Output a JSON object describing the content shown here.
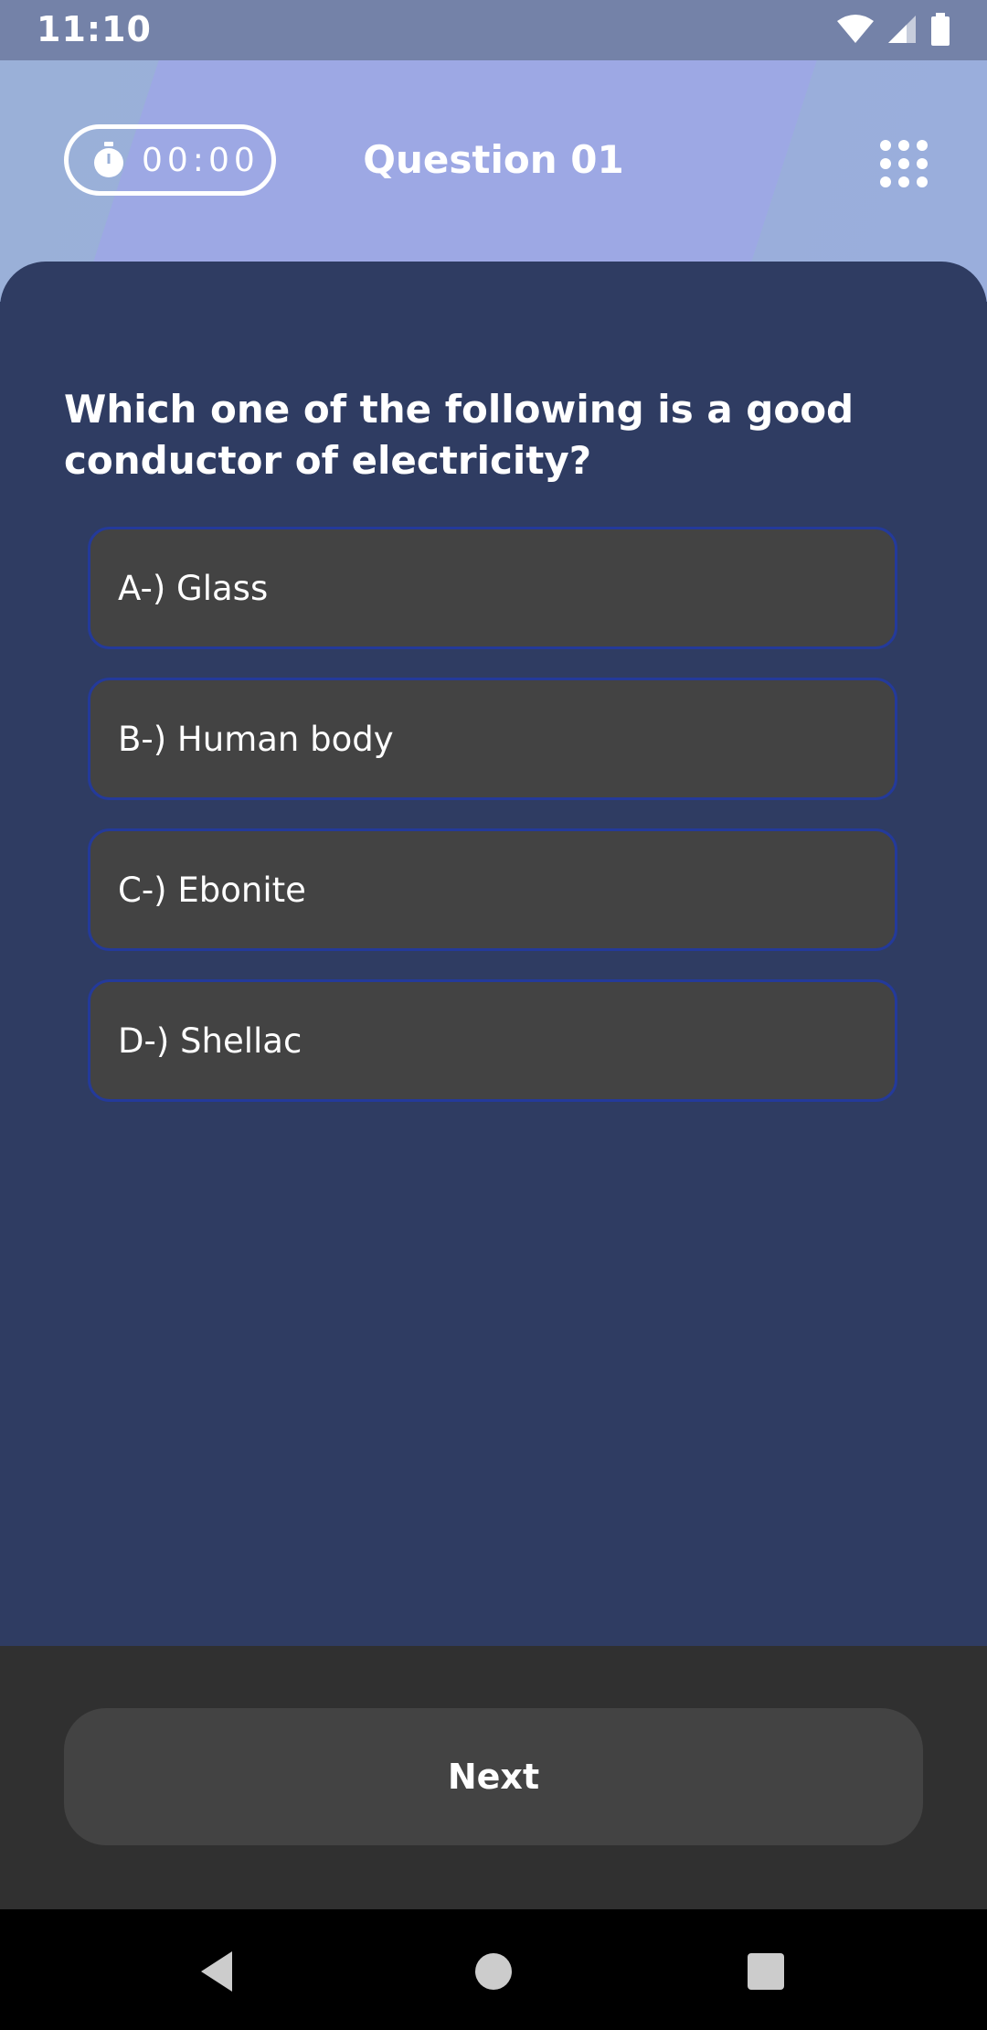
{
  "status_bar": {
    "time": "11:10",
    "icons": [
      "wifi-icon",
      "cell-signal-icon",
      "battery-icon"
    ]
  },
  "header": {
    "timer": {
      "icon": "stopwatch-icon",
      "value": "00:00"
    },
    "title": "Question 01",
    "menu_icon": "grid-dots-icon"
  },
  "question": {
    "text": "Which one of the following is a good conductor of electricity?",
    "options": [
      {
        "label": "A-) Glass"
      },
      {
        "label": "B-) Human body"
      },
      {
        "label": "C-) Ebonite"
      },
      {
        "label": "D-) Shellac"
      }
    ]
  },
  "footer": {
    "next_label": "Next"
  },
  "nav_bar": {
    "icons": [
      "back-icon",
      "home-icon",
      "recents-icon"
    ]
  },
  "colors": {
    "card_bg": "#2f3c62",
    "option_bg": "#434343",
    "option_border": "#243a9a",
    "bottom_bg": "#303030"
  }
}
